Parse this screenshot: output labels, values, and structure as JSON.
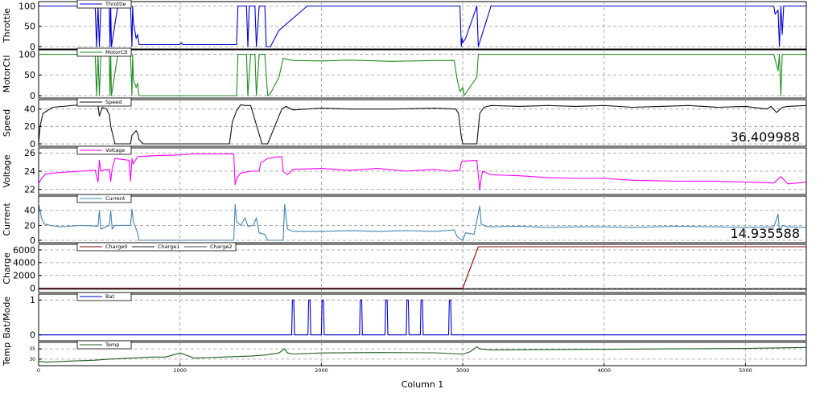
{
  "chart_data": {
    "type": "line",
    "xlabel": "Column 1",
    "x_ticks": [
      "0",
      "1000",
      "2000",
      "3000",
      "4000",
      "5000"
    ],
    "xlim": [
      0,
      5430
    ],
    "panels": [
      {
        "ylabel": "Throttle",
        "ylim": [
          0,
          105
        ],
        "yticks": [
          "0",
          "50",
          "100"
        ],
        "legend": [
          "Throttle"
        ],
        "series": [
          {
            "name": "Throttle",
            "color": "#0000cc",
            "x": [
              0,
              300,
              400,
              410,
              420,
              430,
              440,
              500,
              505,
              510,
              515,
              560,
              650,
              660,
              665,
              670,
              690,
              700,
              710,
              1000,
              1010,
              1020,
              1400,
              1410,
              1420,
              1470,
              1480,
              1490,
              1520,
              1530,
              1540,
              1560,
              1600,
              1610,
              1620,
              1640,
              1700,
              1900,
              2000,
              2950,
              2980,
              2990,
              2995,
              3000,
              3020,
              3040,
              3060,
              3100,
              3110,
              3200,
              3500,
              3600,
              3800,
              4000,
              4500,
              5000,
              5200,
              5210,
              5230,
              5240,
              5250,
              5260,
              5270,
              5430
            ],
            "y": [
              100,
              100,
              100,
              0,
              100,
              0,
              100,
              100,
              0,
              100,
              0,
              100,
              100,
              0,
              100,
              60,
              20,
              30,
              5,
              5,
              10,
              5,
              5,
              100,
              100,
              100,
              0,
              100,
              100,
              100,
              0,
              100,
              100,
              0,
              0,
              0,
              40,
              100,
              100,
              100,
              100,
              0,
              20,
              10,
              20,
              40,
              60,
              100,
              0,
              100,
              100,
              100,
              100,
              100,
              100,
              100,
              100,
              80,
              90,
              0,
              100,
              30,
              100,
              100
            ]
          }
        ]
      },
      {
        "ylabel": "MotorCtl",
        "ylim": [
          0,
          105
        ],
        "yticks": [
          "0",
          "50",
          "100"
        ],
        "legend": [
          "MotorCtl"
        ],
        "series": [
          {
            "name": "MotorCtl",
            "color": "#228b22",
            "x": [
              0,
              300,
              400,
              410,
              420,
              430,
              440,
              500,
              505,
              510,
              515,
              560,
              650,
              660,
              665,
              670,
              690,
              700,
              710,
              1000,
              1400,
              1410,
              1430,
              1470,
              1480,
              1500,
              1520,
              1530,
              1540,
              1560,
              1600,
              1620,
              1640,
              1700,
              1730,
              1800,
              2000,
              2200,
              2500,
              2800,
              2940,
              2960,
              2980,
              3000,
              3010,
              3050,
              3100,
              3110,
              3200,
              3400,
              3600,
              4000,
              4500,
              5000,
              5200,
              5230,
              5240,
              5250,
              5260,
              5430
            ],
            "y": [
              100,
              100,
              100,
              0,
              100,
              0,
              100,
              100,
              0,
              100,
              0,
              100,
              100,
              0,
              100,
              40,
              20,
              30,
              0,
              0,
              0,
              100,
              100,
              100,
              0,
              100,
              100,
              100,
              0,
              100,
              100,
              0,
              5,
              45,
              90,
              85,
              84,
              86,
              83,
              85,
              85,
              40,
              10,
              20,
              0,
              20,
              45,
              100,
              100,
              100,
              100,
              100,
              100,
              100,
              100,
              60,
              100,
              0,
              100,
              100
            ]
          }
        ]
      },
      {
        "ylabel": "Speed",
        "ylim": [
          0,
          48
        ],
        "yticks": [
          "0",
          "20",
          "40"
        ],
        "legend": [
          "Speed"
        ],
        "annotation": "36.409988",
        "series": [
          {
            "name": "Speed",
            "color": "#111111",
            "x": [
              0,
              10,
              30,
              100,
              300,
              420,
              430,
              450,
              480,
              500,
              510,
              540,
              650,
              660,
              690,
              700,
              710,
              740,
              1000,
              1350,
              1370,
              1400,
              1430,
              1460,
              1500,
              1580,
              1600,
              1620,
              1700,
              1720,
              1750,
              1800,
              2000,
              2200,
              2500,
              2800,
              2950,
              2970,
              2990,
              3000,
              3080,
              3100,
              3120,
              3150,
              3200,
              3400,
              3600,
              3800,
              4000,
              4200,
              4400,
              4600,
              4800,
              5000,
              5150,
              5180,
              5220,
              5260,
              5300,
              5430
            ],
            "y": [
              0,
              20,
              35,
              42,
              45,
              44,
              32,
              42,
              40,
              34,
              20,
              0,
              0,
              10,
              15,
              12,
              5,
              0,
              0,
              0,
              25,
              38,
              45,
              44,
              44,
              0,
              0,
              0,
              32,
              40,
              43,
              39,
              41,
              40,
              40,
              41,
              40,
              35,
              8,
              0,
              0,
              0,
              35,
              42,
              44,
              43,
              44,
              43,
              44,
              42,
              43,
              44,
              42,
              43,
              40,
              43,
              36,
              42,
              43,
              44
            ]
          }
        ]
      },
      {
        "ylabel": "Voltage",
        "ylim": [
          21.7,
          26.3
        ],
        "yticks": [
          "22",
          "24",
          "26"
        ],
        "legend": [
          "Voltage"
        ],
        "series": [
          {
            "name": "Voltage",
            "color": "#ff00ff",
            "x": [
              0,
              20,
              50,
              100,
              200,
              300,
              400,
              420,
              430,
              440,
              450,
              500,
              510,
              520,
              540,
              640,
              650,
              660,
              670,
              700,
              800,
              1000,
              1100,
              1300,
              1380,
              1390,
              1400,
              1430,
              1500,
              1560,
              1570,
              1620,
              1700,
              1720,
              1730,
              1760,
              1800,
              2000,
              2200,
              2400,
              2600,
              2800,
              2900,
              2980,
              2990,
              3000,
              3100,
              3120,
              3130,
              3140,
              3200,
              3400,
              3600,
              3800,
              4000,
              4200,
              4500,
              4800,
              5000,
              5200,
              5250,
              5300,
              5430
            ],
            "y": [
              22.6,
              23.2,
              23.7,
              23.8,
              23.9,
              24.0,
              24.1,
              22.8,
              25.2,
              24.0,
              24.1,
              24.2,
              22.9,
              24.3,
              25.4,
              25.2,
              22.9,
              25.4,
              24.8,
              25.6,
              25.7,
              25.8,
              25.9,
              25.9,
              25.9,
              22.5,
              23.2,
              23.8,
              24.0,
              24.0,
              24.9,
              25.4,
              25.6,
              25.6,
              24.0,
              23.6,
              24.2,
              24.3,
              24.1,
              24.3,
              24.0,
              24.2,
              24.0,
              24.1,
              25.0,
              25.1,
              25.2,
              21.9,
              23.2,
              24.0,
              23.6,
              23.5,
              23.3,
              23.2,
              23.2,
              23.0,
              22.9,
              22.9,
              22.8,
              22.7,
              23.4,
              22.6,
              22.8
            ]
          }
        ]
      },
      {
        "ylabel": "Current",
        "ylim": [
          0,
          56
        ],
        "yticks": [
          "0",
          "20",
          "40"
        ],
        "legend": [
          "Current"
        ],
        "annotation": "14.935588",
        "series": [
          {
            "name": "Current",
            "color": "#4682b4",
            "x": [
              0,
              20,
              40,
              80,
              150,
              300,
              420,
              430,
              440,
              500,
              510,
              520,
              540,
              650,
              660,
              670,
              690,
              700,
              710,
              1000,
              1380,
              1390,
              1400,
              1430,
              1460,
              1480,
              1520,
              1540,
              1560,
              1600,
              1620,
              1730,
              1740,
              1760,
              1800,
              2000,
              2200,
              2400,
              2600,
              2800,
              2940,
              2960,
              2980,
              3000,
              3020,
              3080,
              3120,
              3130,
              3160,
              3200,
              3400,
              3600,
              3800,
              4000,
              4200,
              4500,
              4800,
              5000,
              5200,
              5230,
              5240,
              5260,
              5300,
              5430
            ],
            "y": [
              50,
              30,
              22,
              20,
              18,
              20,
              19,
              40,
              15,
              20,
              40,
              15,
              20,
              20,
              42,
              25,
              15,
              10,
              0,
              0,
              0,
              48,
              25,
              20,
              30,
              19,
              20,
              30,
              10,
              8,
              0,
              0,
              48,
              15,
              12,
              12,
              13,
              12,
              13,
              12,
              14,
              5,
              2,
              0,
              10,
              8,
              46,
              22,
              19,
              18,
              19,
              17,
              18,
              18,
              17,
              19,
              18,
              17,
              18,
              35,
              12,
              20,
              18,
              17
            ]
          }
        ]
      },
      {
        "ylabel": "Charge",
        "ylim": [
          -300,
          6500
        ],
        "yticks": [
          "0",
          "2000",
          "4000",
          "6000"
        ],
        "legend": [
          "Charge0",
          "Charge1",
          "Charge2"
        ],
        "series": [
          {
            "name": "Charge0",
            "color": "#8b0000",
            "x": [
              0,
              2990,
              3000,
              3110,
              3120,
              5430
            ],
            "y": [
              0,
              0,
              0,
              6500,
              6500,
              6500
            ]
          },
          {
            "name": "Charge1",
            "color": "#222222",
            "x": [
              0,
              5430
            ],
            "y": [
              -80,
              -80
            ]
          },
          {
            "name": "Charge2",
            "color": "#444444",
            "x": [
              0,
              5430
            ],
            "y": [
              -160,
              -160
            ]
          }
        ]
      },
      {
        "ylabel": "Bat/Mode",
        "ylim": [
          -0.1,
          1.1
        ],
        "yticks": [
          "0",
          "1"
        ],
        "legend": [
          "Bat"
        ],
        "series": [
          {
            "name": "Bat",
            "color": "#0000cc",
            "x": [
              0,
              1790,
              1795,
              1805,
              1810,
              1905,
              1910,
              1920,
              1925,
              2000,
              2005,
              2015,
              2020,
              2270,
              2275,
              2285,
              2290,
              2450,
              2455,
              2465,
              2470,
              2600,
              2605,
              2615,
              2620,
              2700,
              2705,
              2715,
              2720,
              2900,
              2905,
              2915,
              2920,
              5430
            ],
            "y": [
              0,
              0,
              1,
              1,
              0,
              0,
              1,
              1,
              0,
              0,
              1,
              1,
              0,
              0,
              1,
              1,
              0,
              0,
              1,
              1,
              0,
              0,
              1,
              1,
              0,
              0,
              1,
              1,
              0,
              0,
              1,
              1,
              0,
              0
            ]
          }
        ]
      },
      {
        "ylabel": "Temp",
        "ylim": [
          28,
          37
        ],
        "yticks": [
          "30",
          "35"
        ],
        "legend": [
          "Temp"
        ],
        "series": [
          {
            "name": "Temp",
            "color": "#1e5e1e",
            "x": [
              0,
              50,
              200,
              400,
              500,
              650,
              800,
              900,
              1000,
              1100,
              1300,
              1500,
              1600,
              1700,
              1740,
              1760,
              1800,
              2000,
              2400,
              2800,
              3000,
              3050,
              3100,
              3120,
              3200,
              3600,
              4000,
              4500,
              5000,
              5430
            ],
            "y": [
              29,
              28.5,
              29,
              29.5,
              30,
              30.5,
              31,
              31,
              33,
              30.5,
              31,
              31.5,
              32,
              33,
              35,
              33,
              32.5,
              33,
              33.2,
              33.1,
              32.5,
              33.5,
              36,
              35,
              34.5,
              34.7,
              34.8,
              35,
              35.2,
              35.7
            ]
          }
        ]
      }
    ]
  }
}
